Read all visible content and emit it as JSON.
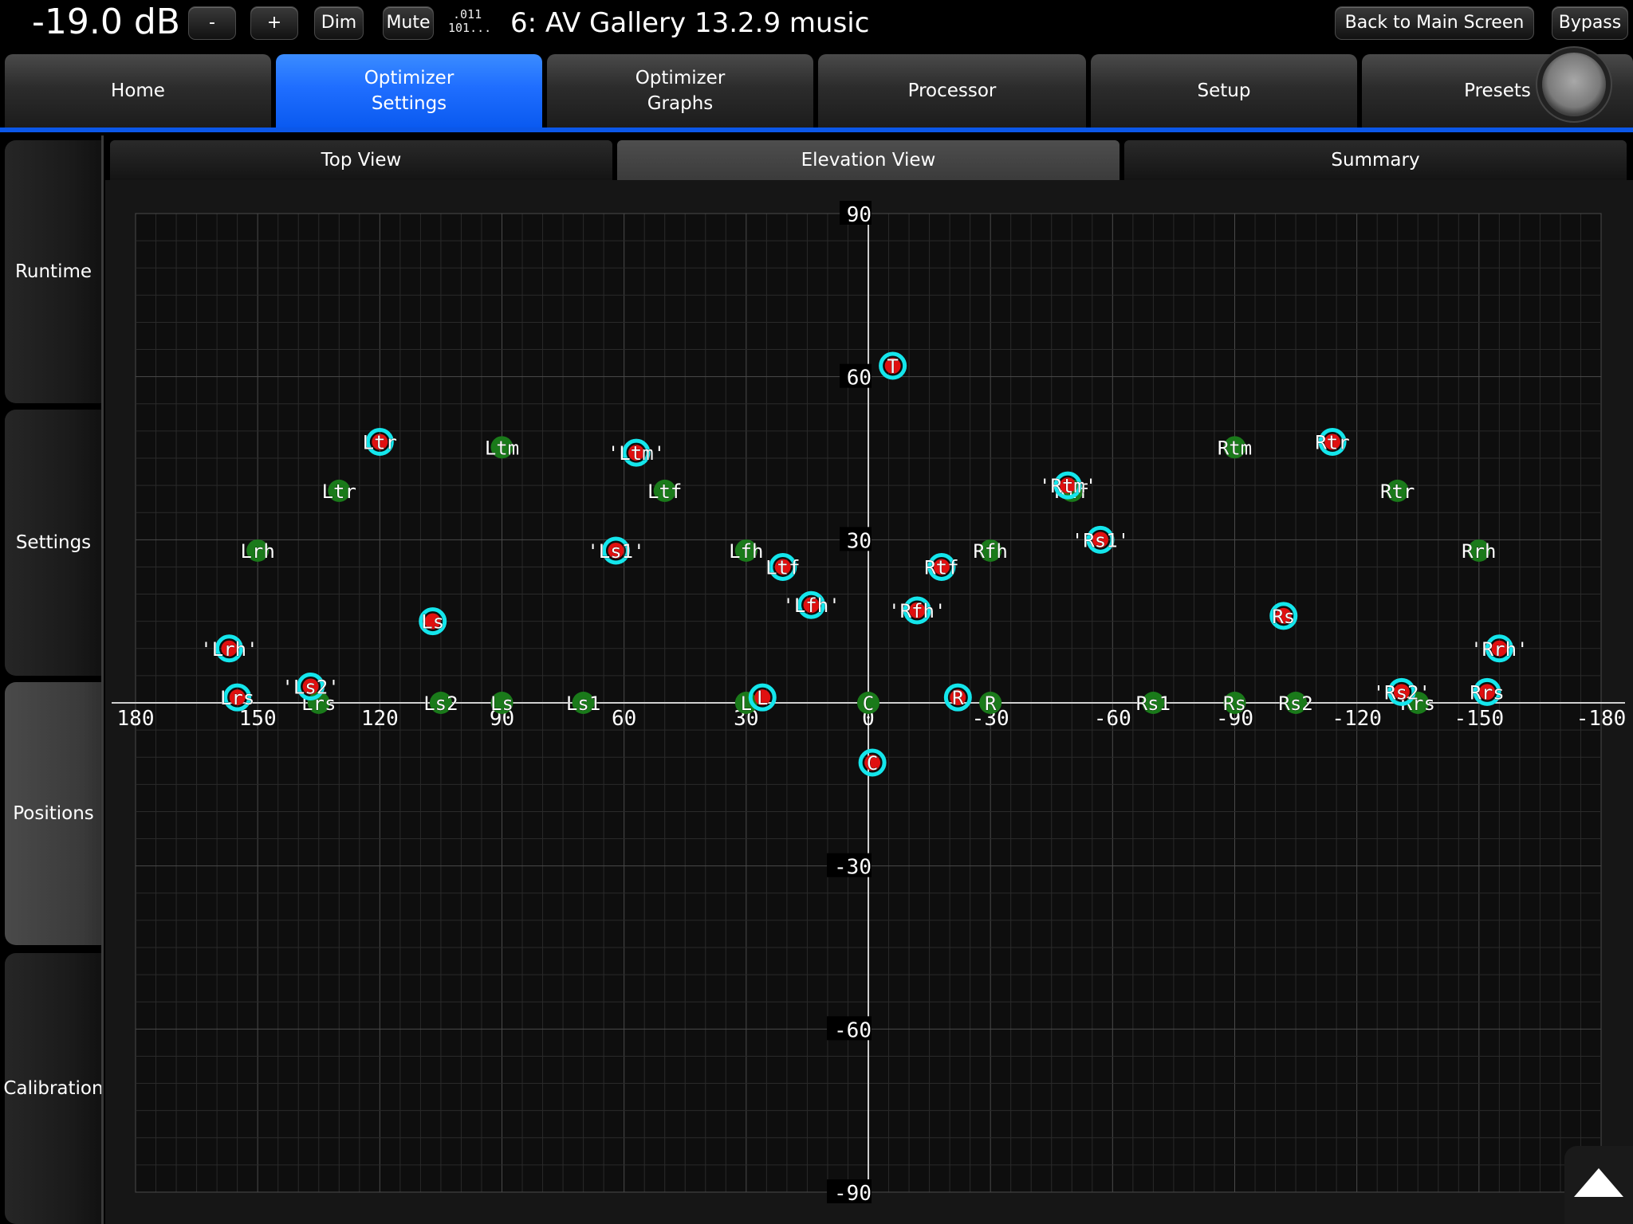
{
  "topbar": {
    "volume": "-19.0 dB",
    "minus_label": "-",
    "plus_label": "+",
    "dim_label": "Dim",
    "mute_label": "Mute",
    "format_line1": ".011",
    "format_line2": "101...",
    "preset_title": "6: AV Gallery 13.2.9 music",
    "back_label": "Back to Main Screen",
    "bypass_label": "Bypass"
  },
  "main_tabs": [
    {
      "label": "Home"
    },
    {
      "label": "Optimizer\nSettings",
      "active": true
    },
    {
      "label": "Optimizer\nGraphs"
    },
    {
      "label": "Processor"
    },
    {
      "label": "Setup"
    },
    {
      "label": "Presets"
    }
  ],
  "side_nav": [
    {
      "label": "Runtime"
    },
    {
      "label": "Settings"
    },
    {
      "label": "Positions",
      "active": true
    },
    {
      "label": "Calibration"
    }
  ],
  "sub_tabs": [
    {
      "label": "Top View"
    },
    {
      "label": "Elevation View",
      "active": true
    },
    {
      "label": "Summary"
    }
  ],
  "colors": {
    "accent": "#0b57e8",
    "marker_green": "#1a7a1a",
    "marker_red": "#e01010",
    "marker_cyan": "#14e6ec",
    "grid": "#3c3c3c"
  },
  "chart_data": {
    "type": "scatter",
    "xlim": [
      180,
      -180
    ],
    "ylim": [
      -90,
      90
    ],
    "x_ticks": [
      "180",
      "150",
      "120",
      "90",
      "60",
      "30",
      "0",
      "-30",
      "-60",
      "-90",
      "-120",
      "-150",
      "-180"
    ],
    "y_ticks": [
      "90",
      "60",
      "30",
      "-30",
      "-60",
      "-90"
    ],
    "grid": true,
    "series": [
      {
        "style": "green",
        "points": [
          {
            "label": "L",
            "x": 30,
            "y": 0
          },
          {
            "label": "C",
            "x": 0,
            "y": 0
          },
          {
            "label": "R",
            "x": -30,
            "y": 0
          },
          {
            "label": "Ls1",
            "x": 70,
            "y": 0
          },
          {
            "label": "Ls",
            "x": 90,
            "y": 0
          },
          {
            "label": "Ls2",
            "x": 105,
            "y": 0
          },
          {
            "label": "Lrs",
            "x": 135,
            "y": 0
          },
          {
            "label": "Rs1",
            "x": -70,
            "y": 0
          },
          {
            "label": "Rs",
            "x": -90,
            "y": 0
          },
          {
            "label": "Rs2",
            "x": -105,
            "y": 0
          },
          {
            "label": "Rrs",
            "x": -135,
            "y": 0
          },
          {
            "label": "Lfh",
            "x": 30,
            "y": 28
          },
          {
            "label": "Rfh",
            "x": -30,
            "y": 28
          },
          {
            "label": "Ltf",
            "x": 50,
            "y": 39
          },
          {
            "label": "Rtf",
            "x": -50,
            "y": 39
          },
          {
            "label": "Ltm",
            "x": 90,
            "y": 47
          },
          {
            "label": "Rtm",
            "x": -90,
            "y": 47
          },
          {
            "label": "Ltr",
            "x": 130,
            "y": 39
          },
          {
            "label": "Rtr",
            "x": -130,
            "y": 39
          },
          {
            "label": "Lrh",
            "x": 150,
            "y": 28
          },
          {
            "label": "Rrh",
            "x": -150,
            "y": 28
          }
        ]
      },
      {
        "style": "red-cyan",
        "points": [
          {
            "label": "L",
            "x": 26,
            "y": 1
          },
          {
            "label": "C",
            "x": -1,
            "y": -11
          },
          {
            "label": "R",
            "x": -22,
            "y": 1
          },
          {
            "label": "T",
            "x": -6,
            "y": 62
          },
          {
            "label": "Ltr",
            "x": 120,
            "y": 48
          },
          {
            "label": "Ls",
            "x": 107,
            "y": 15
          },
          {
            "label": "'Ltm'",
            "x": 57,
            "y": 46
          },
          {
            "label": "'Ls1'",
            "x": 62,
            "y": 28
          },
          {
            "label": "Ltf",
            "x": 21,
            "y": 25
          },
          {
            "label": "'Lfh'",
            "x": 14,
            "y": 18
          },
          {
            "label": "'Rfh'",
            "x": -12,
            "y": 17
          },
          {
            "label": "Rtf",
            "x": -18,
            "y": 25
          },
          {
            "label": "'Rtm'",
            "x": -49,
            "y": 40
          },
          {
            "label": "'Rs1'",
            "x": -57,
            "y": 30
          },
          {
            "label": "Rtr",
            "x": -114,
            "y": 48
          },
          {
            "label": "Rs",
            "x": -102,
            "y": 16
          },
          {
            "label": "'Rrh'",
            "x": -155,
            "y": 10
          },
          {
            "label": "Rrs",
            "x": -152,
            "y": 2
          },
          {
            "label": "'Rs2'",
            "x": -131,
            "y": 2
          },
          {
            "label": "'Lrh'",
            "x": 157,
            "y": 10
          },
          {
            "label": "Lrs",
            "x": 155,
            "y": 1
          },
          {
            "label": "'Ls2'",
            "x": 137,
            "y": 3
          }
        ]
      }
    ]
  }
}
